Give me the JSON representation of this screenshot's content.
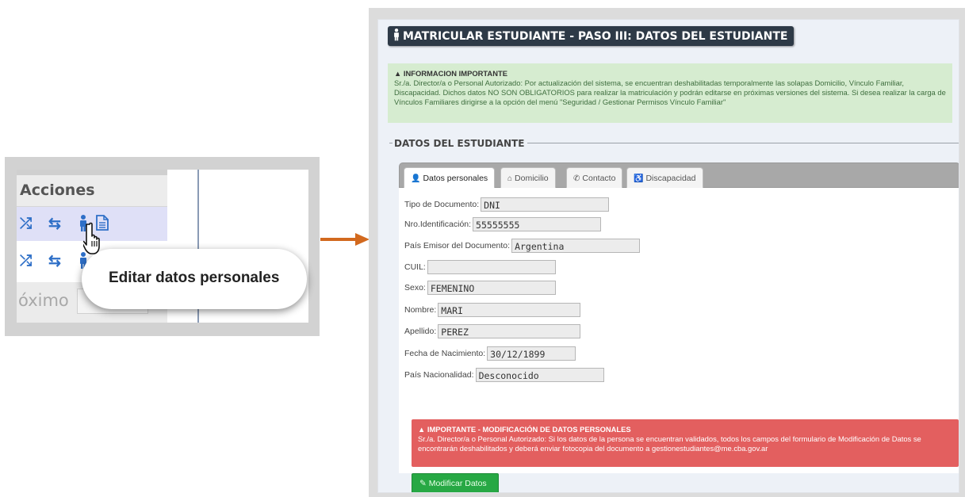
{
  "inset": {
    "header": "Acciones",
    "pager_text": "óximo",
    "tooltip": "Editar datos personales",
    "icons": [
      "shuffle-icon",
      "retweet-icon",
      "person-icon",
      "document-icon",
      "pointer-hand-icon"
    ]
  },
  "page": {
    "title": "MATRICULAR ESTUDIANTE - PASO III: DATOS DEL ESTUDIANTE",
    "info": {
      "heading": "INFORMACION IMPORTANTE",
      "text": "Sr./a. Director/a o Personal Autorizado: Por actualización del sistema, se encuentran deshabilitadas temporalmente las solapas Domicilio, Vínculo Familiar, Discapacidad. Dichos datos NO SON OBLIGATORIOS para realizar la matriculación y podrán editarse en próximas versiones del sistema. Si desea realizar la carga de Vínculos Familiares dirigirse a la opción del menú \"Seguridad / Gestionar Permisos Vínculo Familiar\""
    },
    "section": "DATOS DEL ESTUDIANTE",
    "tabs": [
      {
        "label": "Datos personales",
        "icon": "user-icon"
      },
      {
        "label": "Domicilio",
        "icon": "home-icon"
      },
      {
        "label": "Contacto",
        "icon": "phone-icon"
      },
      {
        "label": "Discapacidad",
        "icon": "wheelchair-icon"
      }
    ],
    "fields": [
      {
        "label": "Tipo de Documento:",
        "value": "DNI"
      },
      {
        "label": "Nro.Identificación:",
        "value": "55555555"
      },
      {
        "label": "País Emisor del Documento:",
        "value": "Argentina"
      },
      {
        "label": "CUIL:",
        "value": ""
      },
      {
        "label": "Sexo:",
        "value": "FEMENINO"
      },
      {
        "label": "Nombre:",
        "value": "MARI"
      },
      {
        "label": "Apellido:",
        "value": "PEREZ"
      },
      {
        "label": "Fecha de Nacimiento:",
        "value": "30/12/1899"
      },
      {
        "label": "País Nacionalidad:",
        "value": "Desconocido"
      }
    ],
    "warning": {
      "heading": "IMPORTANTE - MODIFICACIÓN DE DATOS PERSONALES",
      "text": "Sr./a. Director/a o Personal Autorizado: Si los datos de la persona se encuentran validados, todos los campos del formulario de Modificación de Datos se encontrarán deshabilitados y deberá enviar fotocopia del documento a gestionestudiantes@me.cba.gov.ar"
    },
    "button": "Modificar Datos"
  },
  "colors": {
    "title_bg": "#2e3a47",
    "info_bg": "#d6ecd0",
    "warning_bg": "#e35f5f",
    "button_bg": "#27a844",
    "arrow": "#d2691e",
    "icon_blue": "#2e6fc7"
  }
}
